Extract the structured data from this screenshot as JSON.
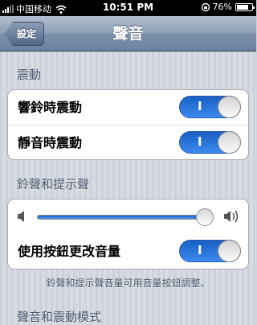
{
  "status_bar": {
    "carrier": "中国移动",
    "time": "10:51 PM",
    "battery": "76%",
    "battery_level": 0.76,
    "icons": [
      "signal-bars-icon",
      "wifi-icon",
      "rotation-lock-icon",
      "battery-icon"
    ]
  },
  "nav": {
    "back_label": "設定",
    "title": "聲音"
  },
  "vibrate": {
    "header": "震動",
    "rows": [
      {
        "label": "響鈴時震動",
        "toggle": "I",
        "on": true
      },
      {
        "label": "靜音時震動",
        "toggle": "I",
        "on": true
      }
    ]
  },
  "ringer": {
    "header": "鈴聲和提示聲",
    "volume_level": 0.96,
    "button_row": {
      "label": "使用按鈕更改音量",
      "toggle": "I",
      "on": true
    },
    "footnote": "鈴聲和提示聲音量可用音量按鈕調整。",
    "volume_icons": [
      "speaker-low-icon",
      "speaker-high-icon"
    ]
  },
  "sounds": {
    "header": "聲音和震動模式"
  },
  "colors": {
    "accent": "#2f7be6",
    "nav": "#7b8fa9",
    "background": "#d3d7de"
  }
}
